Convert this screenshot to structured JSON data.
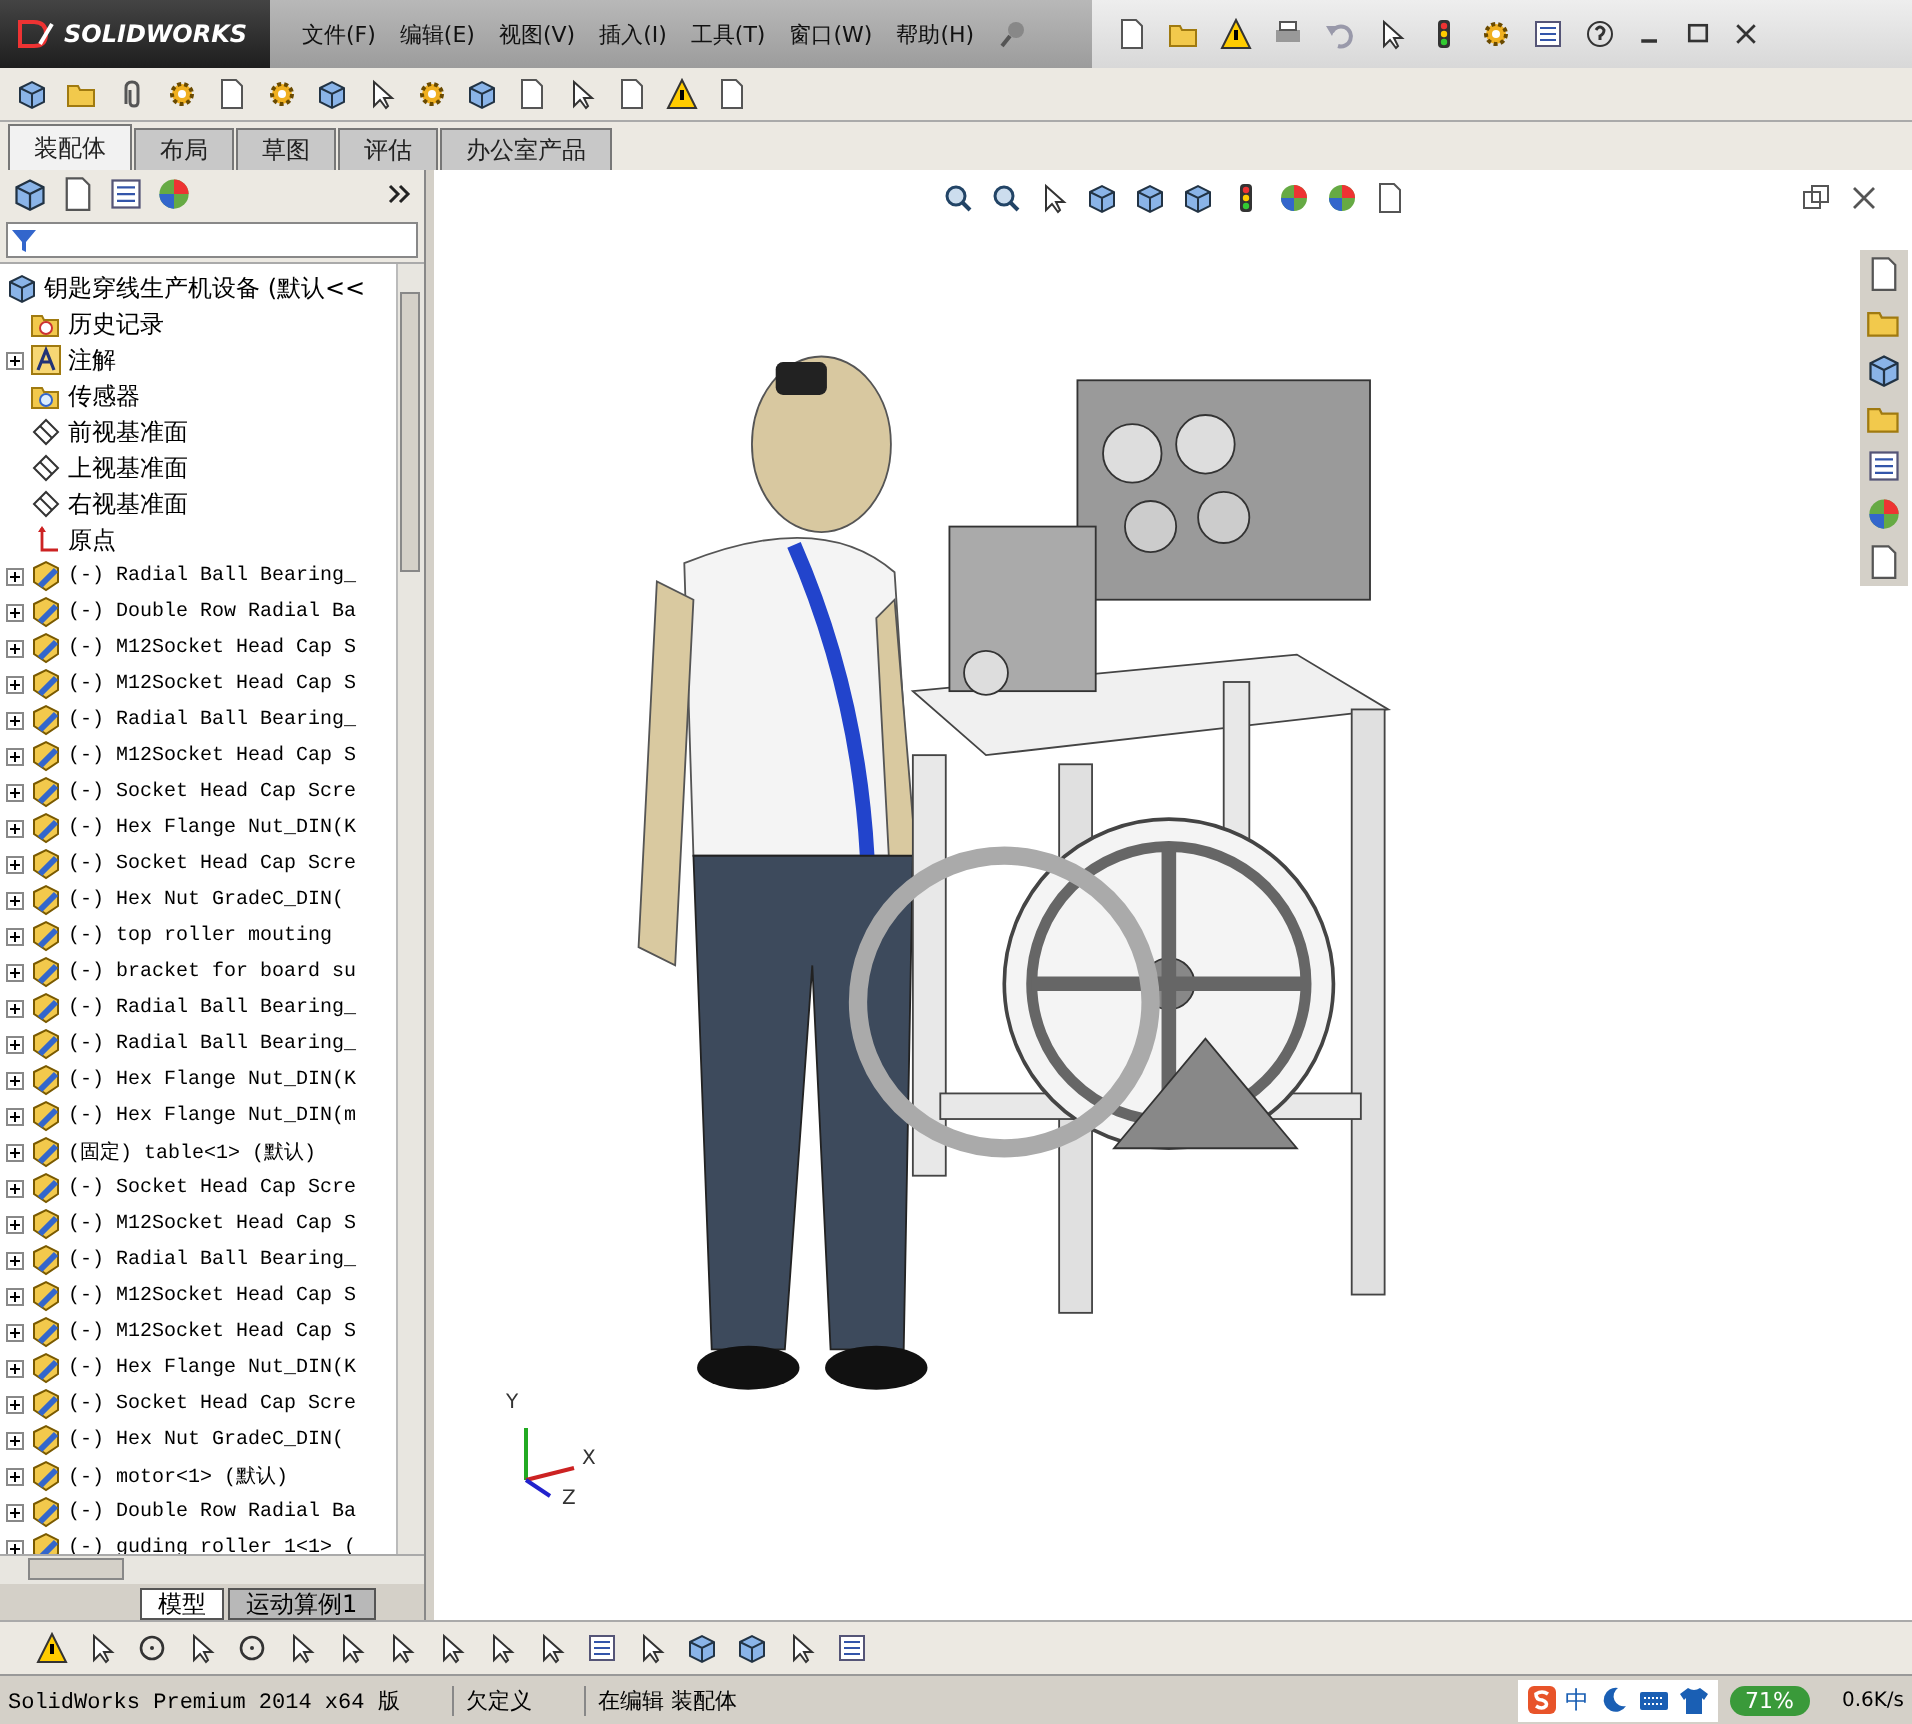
{
  "app": {
    "logo": "SOLIDWORKS"
  },
  "menu": [
    "文件(F)",
    "编辑(E)",
    "视图(V)",
    "插入(I)",
    "工具(T)",
    "窗口(W)",
    "帮助(H)"
  ],
  "tabs": [
    {
      "label": "装配体",
      "selected": true
    },
    {
      "label": "布局",
      "selected": false
    },
    {
      "label": "草图",
      "selected": false
    },
    {
      "label": "评估",
      "selected": false
    },
    {
      "label": "办公室产品",
      "selected": false
    }
  ],
  "tree": [
    {
      "label": "钥匙穿线生产机设备  (默认<<",
      "kind": "root",
      "expandable": false
    },
    {
      "label": "历史记录",
      "kind": "history",
      "expandable": false
    },
    {
      "label": "注解",
      "kind": "annotation",
      "expandable": true
    },
    {
      "label": "传感器",
      "kind": "sensor",
      "expandable": false
    },
    {
      "label": "前视基准面",
      "kind": "plane",
      "expandable": false
    },
    {
      "label": "上视基准面",
      "kind": "plane",
      "expandable": false
    },
    {
      "label": "右视基准面",
      "kind": "plane",
      "expandable": false
    },
    {
      "label": "原点",
      "kind": "origin",
      "expandable": false
    },
    {
      "label": "(-) Radial Ball Bearing_",
      "kind": "component",
      "expandable": true
    },
    {
      "label": "(-) Double Row Radial Ba",
      "kind": "component",
      "expandable": true
    },
    {
      "label": "(-) M12Socket Head Cap S",
      "kind": "component",
      "expandable": true
    },
    {
      "label": "(-) M12Socket Head Cap S",
      "kind": "component",
      "expandable": true
    },
    {
      "label": "(-) Radial Ball Bearing_",
      "kind": "component",
      "expandable": true
    },
    {
      "label": "(-) M12Socket Head Cap S",
      "kind": "component",
      "expandable": true
    },
    {
      "label": "(-) Socket Head Cap Scre",
      "kind": "component",
      "expandable": true
    },
    {
      "label": "(-) Hex Flange Nut_DIN(K",
      "kind": "component",
      "expandable": true
    },
    {
      "label": "(-) Socket Head Cap Scre",
      "kind": "component",
      "expandable": true
    },
    {
      "label": "(-) Hex Nut GradeC_DIN(",
      "kind": "component",
      "expandable": true
    },
    {
      "label": "(-) top  roller mouting",
      "kind": "component",
      "expandable": true
    },
    {
      "label": "(-) bracket for board su",
      "kind": "component",
      "expandable": true
    },
    {
      "label": "(-) Radial Ball Bearing_",
      "kind": "component",
      "expandable": true
    },
    {
      "label": "(-) Radial Ball Bearing_",
      "kind": "component",
      "expandable": true
    },
    {
      "label": "(-) Hex Flange Nut_DIN(K",
      "kind": "component",
      "expandable": true
    },
    {
      "label": "(-) Hex Flange Nut_DIN(m",
      "kind": "component",
      "expandable": true
    },
    {
      "label": "(固定) table<1> (默认)",
      "kind": "component",
      "expandable": true
    },
    {
      "label": "(-) Socket Head Cap Scre",
      "kind": "component",
      "expandable": true
    },
    {
      "label": "(-) M12Socket Head Cap S",
      "kind": "component",
      "expandable": true
    },
    {
      "label": "(-) Radial Ball Bearing_",
      "kind": "component",
      "expandable": true
    },
    {
      "label": "(-) M12Socket Head Cap S",
      "kind": "component",
      "expandable": true
    },
    {
      "label": "(-) M12Socket Head Cap S",
      "kind": "component",
      "expandable": true
    },
    {
      "label": "(-) Hex Flange Nut_DIN(K",
      "kind": "component",
      "expandable": true
    },
    {
      "label": "(-) Socket Head Cap Scre",
      "kind": "component",
      "expandable": true
    },
    {
      "label": "(-) Hex Nut GradeC_DIN(",
      "kind": "component",
      "expandable": true
    },
    {
      "label": "(-) motor<1> (默认)",
      "kind": "component",
      "expandable": true
    },
    {
      "label": "(-) Double Row Radial Ba",
      "kind": "component",
      "expandable": true
    },
    {
      "label": "(-) guding roller 1<1> (",
      "kind": "component",
      "expandable": true
    }
  ],
  "bottom_tabs": [
    {
      "label": "模型",
      "selected": true
    },
    {
      "label": "运动算例1",
      "selected": false
    }
  ],
  "triad": {
    "x": "X",
    "y": "Y",
    "z": "Z"
  },
  "status_bar": {
    "product": "SolidWorks Premium 2014 x64 版",
    "state": "欠定义",
    "mode": "在编辑 装配体"
  },
  "tray": {
    "ime": "中",
    "meter": "71%",
    "speed": "0.6K/s"
  }
}
